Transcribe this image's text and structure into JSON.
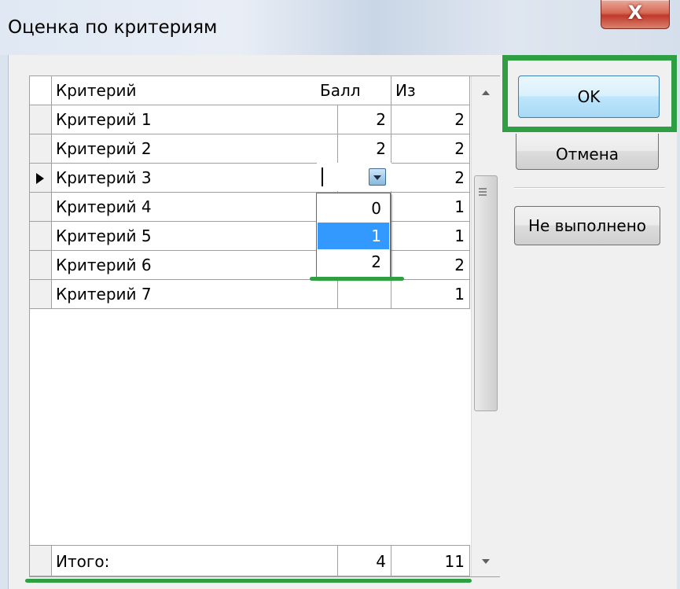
{
  "window": {
    "title": "Оценка по критериям",
    "close_glyph": "X"
  },
  "grid": {
    "headers": {
      "criterion": "Критерий",
      "score": "Балл",
      "max": "Из"
    },
    "rows": [
      {
        "name": "Критерий 1",
        "score": "2",
        "max": "2"
      },
      {
        "name": "Критерий 2",
        "score": "2",
        "max": "2"
      },
      {
        "name": "Критерий 3",
        "score": "",
        "max": "2"
      },
      {
        "name": "Критерий 4",
        "score": "",
        "max": "1"
      },
      {
        "name": "Критерий 5",
        "score": "",
        "max": "1"
      },
      {
        "name": "Критерий 6",
        "score": "",
        "max": "2"
      },
      {
        "name": "Критерий 7",
        "score": "",
        "max": "1"
      }
    ],
    "current_row": 3,
    "footer": {
      "label": "Итого:",
      "score_total": "4",
      "max_total": "11"
    }
  },
  "dropdown": {
    "options": [
      "0",
      "1",
      "2"
    ],
    "selected": "1"
  },
  "buttons": {
    "ok": "OK",
    "cancel": "Отмена",
    "not_done": "Не выполнено"
  },
  "colors": {
    "highlight_green": "#2ea043",
    "selection_blue": "#3399ff"
  }
}
